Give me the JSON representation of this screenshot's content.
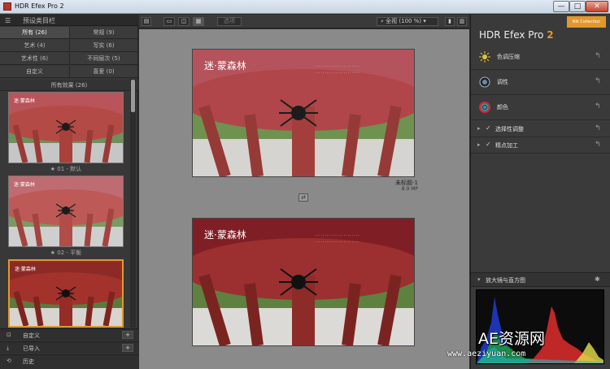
{
  "window": {
    "title": "HDR Efex Pro 2",
    "min_label": "—",
    "max_label": "□",
    "close_label": "✕"
  },
  "left_panel": {
    "header_title": "预设类目栏",
    "categories": [
      {
        "label": "所有 (26)",
        "active": true
      },
      {
        "label": "常规 (9)"
      },
      {
        "label": "艺术 (4)"
      },
      {
        "label": "写实 (6)"
      },
      {
        "label": "艺术性 (6)"
      },
      {
        "label": "不同层次 (5)"
      },
      {
        "label": "自定义"
      },
      {
        "label": "喜爱 (0)"
      }
    ],
    "section_title": "所有效果 (26)",
    "presets": [
      {
        "caption": "★ 01 - 默认"
      },
      {
        "caption": "★ 02 - 平衡"
      },
      {
        "caption": ""
      }
    ],
    "footer": [
      {
        "icon": "user-icon",
        "label": "自定义"
      },
      {
        "icon": "import-icon",
        "label": "已导入"
      },
      {
        "icon": "history-icon",
        "label": "历史"
      }
    ],
    "plus_label": "+"
  },
  "toolbar": {
    "zoom_label": "全视 (100 %)",
    "layout_btns": [
      "▭",
      "◫",
      "▦"
    ],
    "options_label": "选项"
  },
  "canvas": {
    "image_caption": "未标题-1",
    "image_size": "8.9 MP",
    "compare_label": "⇄"
  },
  "right_panel": {
    "title_main": "HDR Efex Pro",
    "title_num": "2",
    "logo_text": "Nik Collection",
    "rows": [
      {
        "icon": "sun-icon",
        "label": "色调压缩"
      },
      {
        "icon": "tone-icon",
        "label": "调性"
      },
      {
        "icon": "color-icon",
        "label": "颜色"
      }
    ],
    "subrows": [
      {
        "label": "选择性调整"
      },
      {
        "label": "精点加工"
      }
    ],
    "reset_label": "↰",
    "histogram_label": "放大镜与直方图",
    "pin_label": "✱"
  },
  "watermark": {
    "line1": "AE资源网",
    "line2": "www.aeziyuan.com"
  },
  "colors": {
    "accent": "#e2982b",
    "panel": "#383838",
    "canvas": "#8a8a8a"
  }
}
